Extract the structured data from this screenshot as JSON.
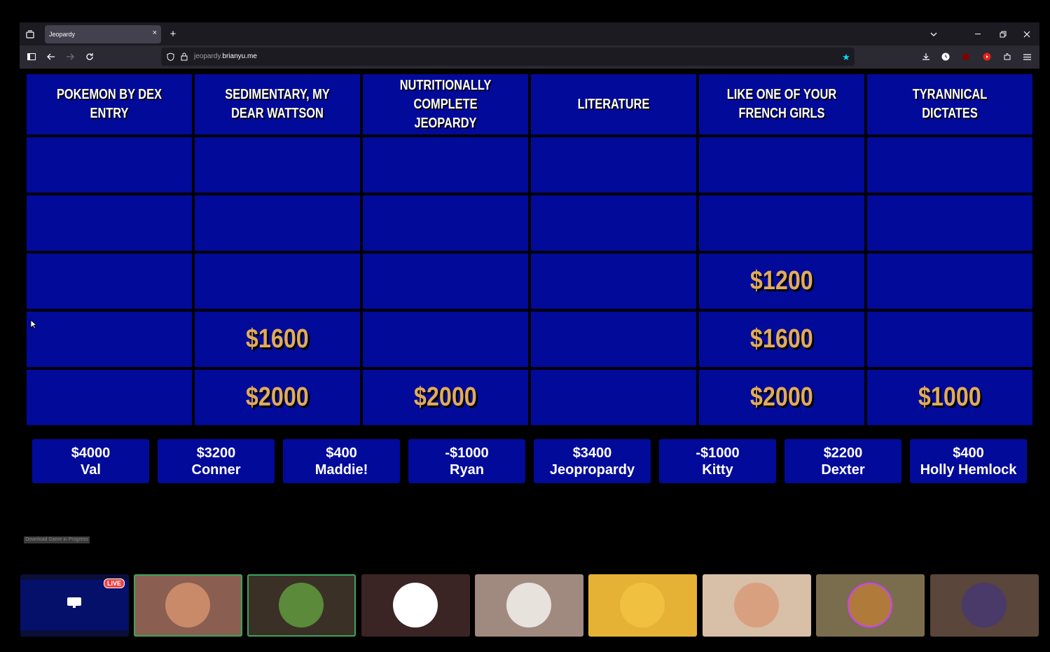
{
  "browser": {
    "tab_title": "Jeopardy",
    "url_prefix": "jeopardy.",
    "url_domain": "brianyu.me",
    "new_tab": "+",
    "tab_close": "×"
  },
  "board": {
    "categories": [
      "POKEMON BY DEX ENTRY",
      "SEDIMENTARY, MY DEAR WATTSON",
      "NUTRITIONALLY COMPLETE JEOPARDY",
      "LITERATURE",
      "LIKE ONE OF YOUR FRENCH GIRLS",
      "TYRANNICAL DICTATES"
    ],
    "rows": [
      [
        "",
        "",
        "",
        "",
        "",
        ""
      ],
      [
        "",
        "",
        "",
        "",
        "",
        ""
      ],
      [
        "",
        "",
        "",
        "",
        "$1200",
        ""
      ],
      [
        "",
        "$1600",
        "",
        "",
        "$1600",
        ""
      ],
      [
        "",
        "$2000",
        "$2000",
        "",
        "$2000",
        "$1000"
      ]
    ]
  },
  "scores": [
    {
      "amount": "$4000",
      "name": "Val"
    },
    {
      "amount": "$3200",
      "name": "Conner"
    },
    {
      "amount": "$400",
      "name": "Maddie!"
    },
    {
      "amount": "-$1000",
      "name": "Ryan"
    },
    {
      "amount": "$3400",
      "name": "Jeopropardy"
    },
    {
      "amount": "-$1000",
      "name": "Kitty"
    },
    {
      "amount": "$2200",
      "name": "Dexter"
    },
    {
      "amount": "$400",
      "name": "Holly Hemlock"
    }
  ],
  "download_label": "Download Game in Progress",
  "call": {
    "live_badge": "LIVE",
    "tiles": [
      {
        "bg": "#8b5e52",
        "avatar": "#c98a6a",
        "speaking": true
      },
      {
        "bg": "#3b3025",
        "avatar": "#5a8a3a",
        "speaking": true
      },
      {
        "bg": "#3b2424",
        "avatar": "#ffffff",
        "speaking": false
      },
      {
        "bg": "#a08a80",
        "avatar": "#e8e2dc",
        "speaking": false
      },
      {
        "bg": "#e5b235",
        "avatar": "#f0c040",
        "speaking": false
      },
      {
        "bg": "#d7bfa8",
        "avatar": "#d9a080",
        "speaking": false
      },
      {
        "bg": "#7a6d4e",
        "avatar": "#b07a3a",
        "speaking": false
      },
      {
        "bg": "#5a463a",
        "avatar": "#4a3a6a",
        "speaking": false
      }
    ]
  }
}
